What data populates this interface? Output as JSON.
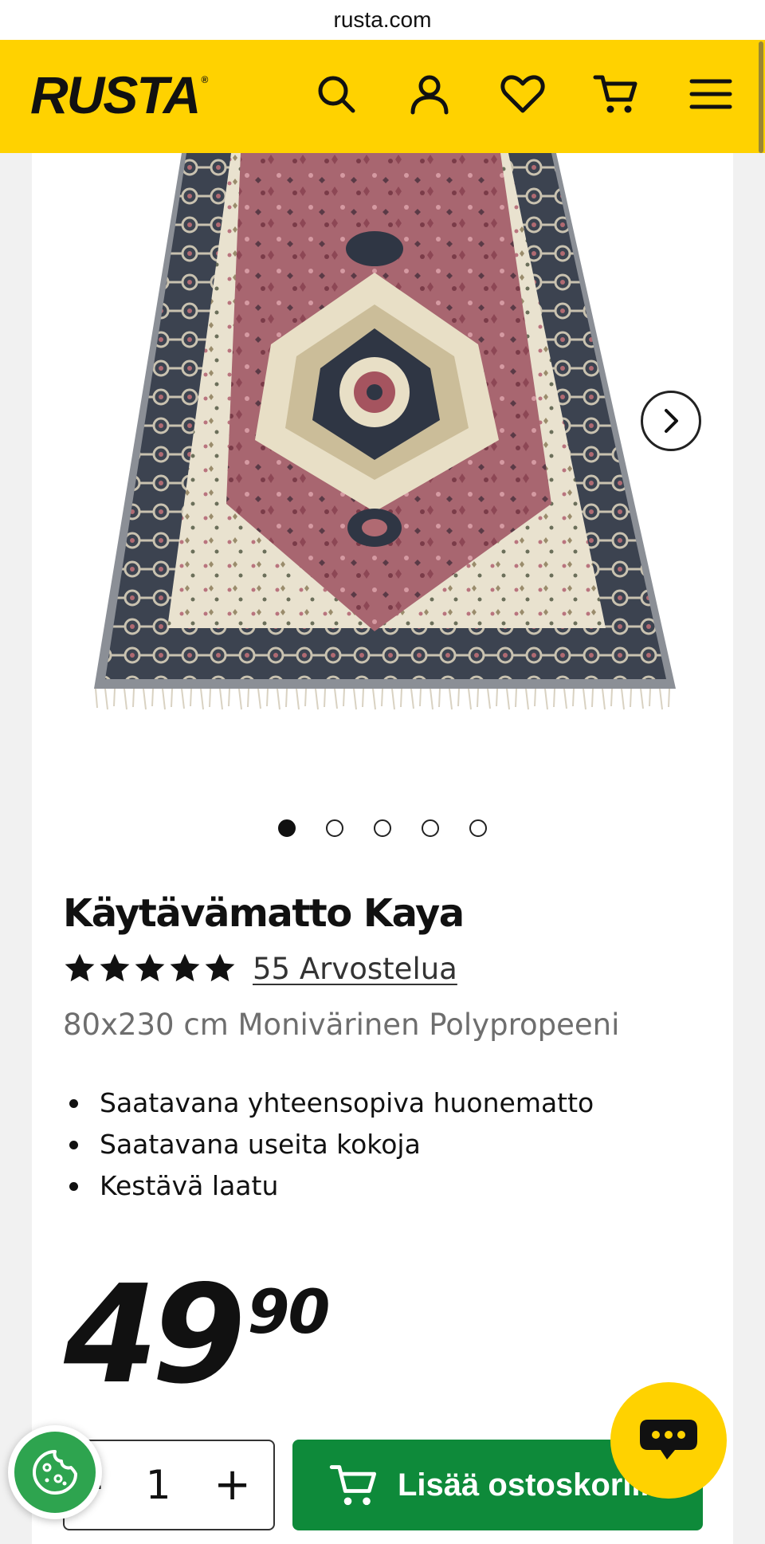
{
  "browser": {
    "url": "rusta.com"
  },
  "header": {
    "logo_text": "RUSTA",
    "logo_mark": "®",
    "icons": [
      "search-icon",
      "account-icon",
      "favorites-icon",
      "cart-icon",
      "menu-icon"
    ],
    "brand_color": "#ffd200"
  },
  "gallery": {
    "image_count": 5,
    "active_index": 0,
    "next_icon": "chevron-right-icon"
  },
  "product": {
    "title": "Käytävämatto Kaya",
    "rating_stars": 5,
    "reviews_label": "55 Arvostelua",
    "subtitle": "80x230 cm Monivärinen Polypropeeni",
    "features": [
      "Saatavana yhteensopiva huonematto",
      "Saatavana useita kokoja",
      "Kestävä laatu"
    ],
    "price_integer": "49",
    "price_decimal": "90"
  },
  "purchase": {
    "minus_label": "-",
    "quantity": "1",
    "plus_label": "+",
    "add_to_cart_label": "Lisää ostoskoriin",
    "add_to_cart_color": "#0e8a3a"
  },
  "floating": {
    "cookie_icon": "cookie-icon",
    "chat_icon": "chat-icon",
    "cookie_color": "#2ea44f",
    "chat_color": "#ffd200"
  }
}
